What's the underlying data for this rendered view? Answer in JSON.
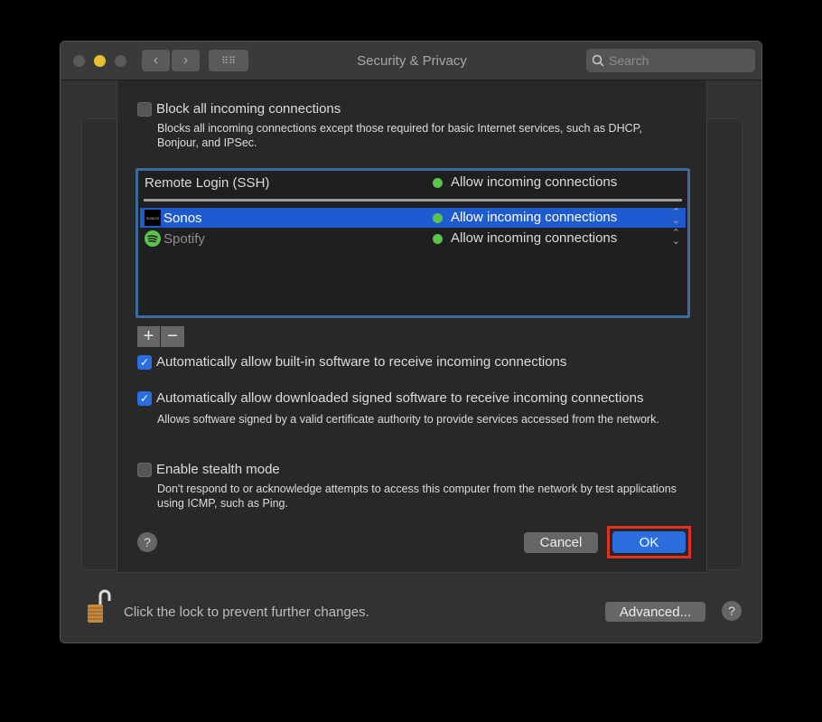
{
  "window": {
    "title": "Security & Privacy",
    "search_placeholder": "Search"
  },
  "sheet": {
    "block_all": {
      "label": "Block all incoming connections",
      "checked": false,
      "description": "Blocks all incoming connections except those required for basic Internet services, such as DHCP, Bonjour, and IPSec."
    },
    "list": {
      "header": {
        "name": "Remote Login (SSH)",
        "status": "Allow incoming connections"
      },
      "rows": [
        {
          "name": "Sonos",
          "icon": "sonos-icon",
          "status": "Allow incoming connections",
          "selected": true
        },
        {
          "name": "Spotify",
          "icon": "spotify-icon",
          "status": "Allow incoming connections",
          "selected": false
        }
      ]
    },
    "add_label": "+",
    "remove_label": "−",
    "auto_builtin": {
      "label": "Automatically allow built-in software to receive incoming connections",
      "checked": true
    },
    "auto_signed": {
      "label": "Automatically allow downloaded signed software to receive incoming connections",
      "checked": true,
      "description": "Allows software signed by a valid certificate authority to provide services accessed from the network."
    },
    "stealth": {
      "label": "Enable stealth mode",
      "checked": false,
      "description": "Don't respond to or acknowledge attempts to access this computer from the network by test applications using ICMP, such as Ping."
    },
    "help": "?",
    "cancel": "Cancel",
    "ok": "OK"
  },
  "footer": {
    "lock_text": "Click the lock to prevent further changes.",
    "advanced": "Advanced...",
    "help": "?"
  },
  "colors": {
    "accent": "#2c6ee0",
    "highlight": "#1f5bd0",
    "status_green": "#5bc44b",
    "annotation": "#e0321e"
  }
}
